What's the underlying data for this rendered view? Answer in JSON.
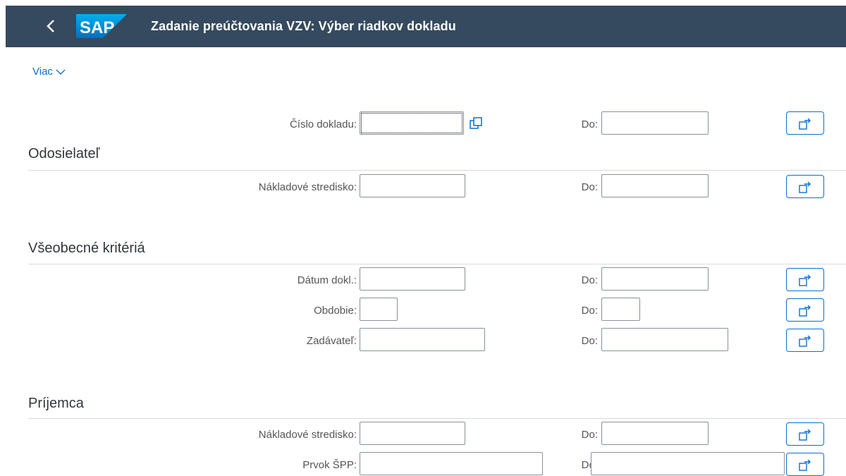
{
  "shell": {
    "back_label": "<",
    "logo_text": "SAP",
    "title": "Zadanie preúčtovania VZV: Výber riadkov dokladu"
  },
  "more_link": "Viac",
  "doc_number": {
    "label": "Číslo dokladu:",
    "to_label": "Do:",
    "value": "",
    "to_value": ""
  },
  "sections": {
    "sender": {
      "title": "Odosielateľ",
      "cost_center": {
        "label": "Nákladové stredisko:",
        "to_label": "Do:"
      }
    },
    "general": {
      "title": "Všeobecné kritériá",
      "doc_date": {
        "label": "Dátum dokl.:",
        "to_label": "Do:"
      },
      "period": {
        "label": "Obdobie:",
        "to_label": "Do:"
      },
      "entered_by": {
        "label": "Zadávateľ:",
        "to_label": "Do:"
      }
    },
    "receiver": {
      "title": "Príjemca",
      "cost_center": {
        "label": "Nákladové stredisko:",
        "to_label": "Do:"
      },
      "wbs": {
        "label": "Prvok ŠPP:",
        "to_label": "Do:"
      }
    }
  },
  "icons": {
    "back": "chevron-left-icon",
    "more": "chevron-down-icon",
    "value_help": "value-help-icon",
    "multiple_selection": "multiple-selection-icon"
  },
  "colors": {
    "shell_bg": "#354a5f",
    "accent": "#0a6ed1",
    "logo_blue": "#1a8fd8"
  }
}
